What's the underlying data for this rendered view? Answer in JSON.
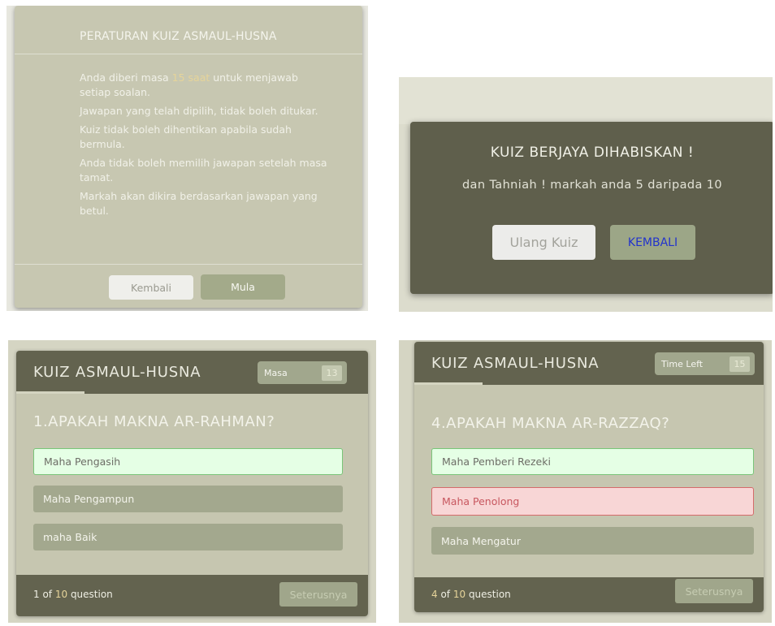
{
  "rules_panel": {
    "title": "PERATURAN KUIZ ASMAUL-HUSNA",
    "rule1_pre": "Anda diberi masa ",
    "rule1_time": "15 saat",
    "rule1_post": " untuk menjawab setiap soalan.",
    "rules": [
      "Jawapan yang telah dipilih, tidak boleh ditukar.",
      "Kuiz tidak boleh dihentikan apabila sudah bermula.",
      "Anda tidak boleh memilih jawapan setelah masa tamat.",
      "Markah akan dikira berdasarkan jawapan yang betul."
    ],
    "back_label": "Kembali",
    "start_label": "Mula"
  },
  "result_panel": {
    "title": "KUIZ BERJAYA DIHABISKAN !",
    "score_text": "dan Tahniah ! markah anda 5 daripada 10",
    "retry_label": "Ulang Kuiz",
    "home_label": "KEMBALI"
  },
  "quiz1": {
    "app_title": "KUIZ ASMAUL-HUSNA",
    "timer_label": "Masa",
    "timer_value": "13",
    "question": "1.APAKAH MAKNA AR-RAHMAN?",
    "options": [
      "Maha Pengasih",
      "Maha Pengampun",
      "maha Baik"
    ],
    "correct_index": 0,
    "count_current": "1",
    "count_of": " of ",
    "count_total": "10",
    "count_suffix": " question",
    "next_label": "Seterusnya"
  },
  "quiz2": {
    "app_title": "KUIZ ASMAUL-HUSNA",
    "timer_label": "Time Left",
    "timer_value": "15",
    "question": "4.APAKAH MAKNA AR-RAZZAQ?",
    "options": [
      "Maha Pemberi Rezeki",
      "Maha Penolong",
      "Maha Mengatur"
    ],
    "correct_index": 0,
    "wrong_index": 1,
    "count_current": "4",
    "count_of": " of ",
    "count_total": "10",
    "count_suffix": " question",
    "next_label": "Seterusnya"
  },
  "colors": {
    "header_dark": "#63634f",
    "card_bg": "#c6c6b0",
    "option_bg": "#a3a88e",
    "correct_bg": "#e5ffe5",
    "wrong_bg": "#f8d6d6",
    "accent_number": "#e6d49a"
  }
}
